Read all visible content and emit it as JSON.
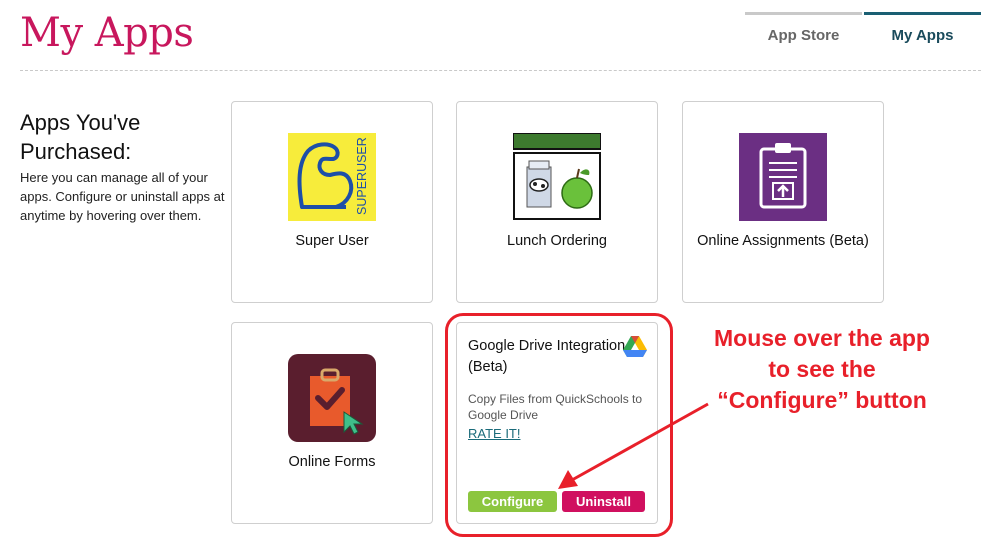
{
  "header": {
    "title": "My Apps",
    "tabs": [
      {
        "label": "App Store",
        "active": false
      },
      {
        "label": "My Apps",
        "active": true
      }
    ]
  },
  "intro": {
    "heading_line1": "Apps You've",
    "heading_line2": "Purchased:",
    "description": "Here you can manage all of your apps. Configure or uninstall apps at anytime by hovering over them."
  },
  "apps": [
    {
      "name": "Super User",
      "icon": "superuser-logo",
      "logo_text": "SUPERUSER"
    },
    {
      "name": "Lunch Ordering",
      "icon": "lunch-ordering-logo"
    },
    {
      "name": "Online Assignments (Beta)",
      "icon": "online-assignments-logo"
    },
    {
      "name": "Online Forms",
      "icon": "online-forms-logo"
    }
  ],
  "hovered_app": {
    "title_line1": "Google Drive Integration",
    "title_line2": "(Beta)",
    "icon": "google-drive-icon",
    "description": "Copy Files from QuickSchools to Google Drive",
    "rate_label": "RATE IT!",
    "configure_label": "Configure",
    "uninstall_label": "Uninstall"
  },
  "annotation": {
    "line1": "Mouse over the app",
    "line2": "to see the",
    "line3": "“Configure” button"
  },
  "colors": {
    "title": "#c8175d",
    "tab_active": "#1a5f73",
    "configure": "#8cc63f",
    "uninstall": "#d0105f",
    "annotation": "#e8202a"
  }
}
